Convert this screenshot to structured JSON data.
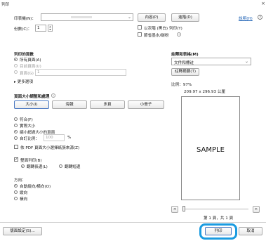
{
  "window": {
    "title": "列印",
    "close_glyph": "×"
  },
  "printer": {
    "label": "印表機(N)：",
    "properties_label": "內容(P)",
    "advanced_label": "進階(D)",
    "help_label": "說明(H)",
    "help_icon": "question-circle-icon"
  },
  "copies": {
    "label": "份數(C)：",
    "value": "1",
    "grayscale_label": "以灰階 (黑白) 列印(Y)",
    "save_ink_label": "節省墨水/碳粉",
    "info_icon": "info-icon"
  },
  "pages": {
    "section_title": "列印的頁數",
    "options": [
      {
        "label": "所有頁面(A)",
        "selected": true,
        "disabled": false
      },
      {
        "label": "目前頁面(U)",
        "selected": false,
        "disabled": true
      },
      {
        "label": "頁面(G)",
        "selected": false,
        "disabled": true
      }
    ],
    "page_range_value": "1",
    "more_options_label": "更多選項"
  },
  "sizing": {
    "section_title": "頁面大小調整和處理",
    "buttons": [
      "大小(I)",
      "海報",
      "多頁",
      "小冊子"
    ],
    "selected_button": 0,
    "options": [
      {
        "label": "符合(F)",
        "selected": false
      },
      {
        "label": "實際大小",
        "selected": false
      },
      {
        "label": "縮小超過大小的頁面",
        "selected": true
      },
      {
        "label": "自訂比例：",
        "selected": false
      }
    ],
    "custom_scale_value": "100",
    "custom_scale_unit": "%",
    "pdf_paper_label": "依 PDF 頁面大小選擇紙張來源(Z)"
  },
  "duplex": {
    "checkbox_label": "雙面列印(B)",
    "checked": true,
    "options": [
      {
        "label": "翻轉長邊(L)",
        "selected": true
      },
      {
        "label": "翻轉短邊",
        "selected": false
      }
    ]
  },
  "orientation": {
    "title": "方向：",
    "options": [
      {
        "label": "自動縱向/橫向(O)",
        "selected": true
      },
      {
        "label": "縱向",
        "selected": false
      },
      {
        "label": "橫向",
        "selected": false
      }
    ]
  },
  "comments": {
    "section_title": "註釋和表格(M)",
    "select_value": "文件和標註",
    "summarize_label": "註釋摘要(T)"
  },
  "preview": {
    "scale_text": "比例：97%",
    "paper_size_text": "209.97 x 296.93 公厘",
    "sample_text": "SAMPLE",
    "prev_glyph": "<",
    "next_glyph": ">",
    "page_indicator": "第 1 頁，共 1 頁"
  },
  "footer": {
    "page_setup_label": "版面設定(S)...",
    "print_label": "列印",
    "cancel_label": "取消"
  },
  "colors": {
    "highlight_ring": "#1a9be0",
    "selected_tab_border": "#4a78c2",
    "link": "#1a5fb4"
  }
}
